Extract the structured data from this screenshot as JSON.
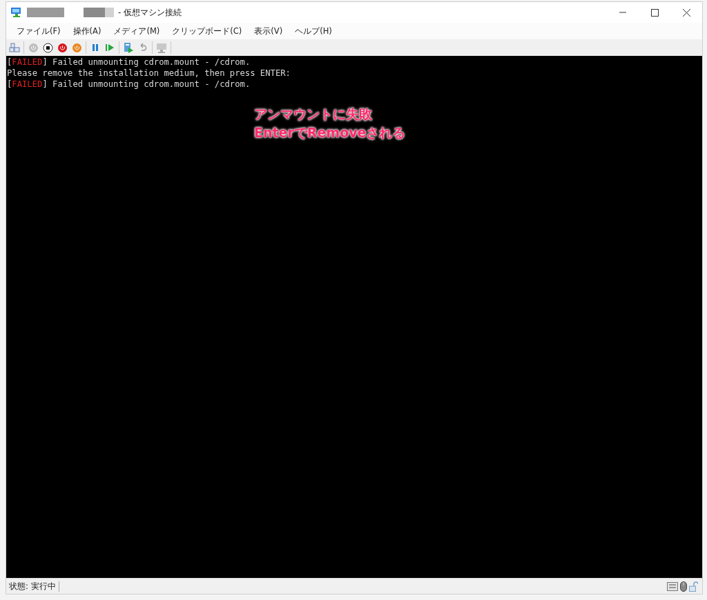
{
  "window": {
    "title": "- 仮想マシン接続"
  },
  "menu": [
    {
      "label": "ファイル(F)"
    },
    {
      "label": "操作(A)"
    },
    {
      "label": "メディア(M)"
    },
    {
      "label": "クリップボード(C)"
    },
    {
      "label": "表示(V)"
    },
    {
      "label": "ヘルプ(H)"
    }
  ],
  "console": {
    "lines": [
      {
        "kind": "status",
        "open": "[",
        "status": "FAILED",
        "close": "]",
        "text": " Failed unmounting cdrom.mount - /cdrom."
      },
      {
        "kind": "plain",
        "text": "Please remove the installation medium, then press ENTER:"
      },
      {
        "kind": "status",
        "open": "[",
        "status": "FAILED",
        "close": "]",
        "text": " Failed unmounting cdrom.mount - /cdrom."
      }
    ]
  },
  "annotation": {
    "lines": [
      "アンマウントに失敗",
      "EnterでRemoveされる"
    ]
  },
  "status_bar": {
    "text": "状態: 実行中"
  }
}
